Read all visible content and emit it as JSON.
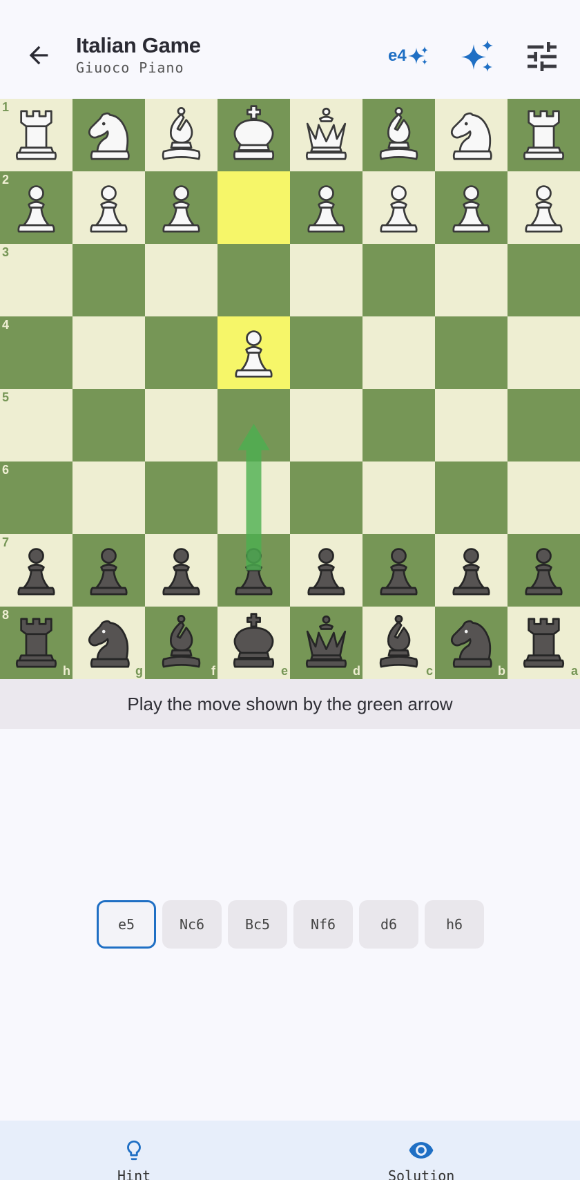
{
  "header": {
    "title": "Italian Game",
    "subtitle": "Giuoco Piano",
    "current_move": "e4",
    "back_icon": "arrow-back-icon",
    "sparkle_icon": "ai-sparkle-icon",
    "settings_icon": "tune-icon",
    "accent": "#1f6fc4"
  },
  "board": {
    "orientation": "black-bottom",
    "light_color": "#eeeed2",
    "dark_color": "#769656",
    "highlight_color": "#f6f669",
    "ranks": [
      "1",
      "2",
      "3",
      "4",
      "5",
      "6",
      "7",
      "8"
    ],
    "files": [
      "h",
      "g",
      "f",
      "e",
      "d",
      "c",
      "b",
      "a"
    ],
    "highlights": [
      "e2",
      "e4"
    ],
    "arrow": {
      "from": "e7",
      "to": "e5",
      "color": "#4caf50"
    },
    "pieces": [
      {
        "sq": "h1",
        "type": "R",
        "color": "w"
      },
      {
        "sq": "g1",
        "type": "N",
        "color": "w"
      },
      {
        "sq": "f1",
        "type": "B",
        "color": "w"
      },
      {
        "sq": "e1",
        "type": "K",
        "color": "w"
      },
      {
        "sq": "d1",
        "type": "Q",
        "color": "w"
      },
      {
        "sq": "c1",
        "type": "B",
        "color": "w"
      },
      {
        "sq": "b1",
        "type": "N",
        "color": "w"
      },
      {
        "sq": "a1",
        "type": "R",
        "color": "w"
      },
      {
        "sq": "h2",
        "type": "P",
        "color": "w"
      },
      {
        "sq": "g2",
        "type": "P",
        "color": "w"
      },
      {
        "sq": "f2",
        "type": "P",
        "color": "w"
      },
      {
        "sq": "d2",
        "type": "P",
        "color": "w"
      },
      {
        "sq": "c2",
        "type": "P",
        "color": "w"
      },
      {
        "sq": "b2",
        "type": "P",
        "color": "w"
      },
      {
        "sq": "a2",
        "type": "P",
        "color": "w"
      },
      {
        "sq": "e4",
        "type": "P",
        "color": "w"
      },
      {
        "sq": "h7",
        "type": "P",
        "color": "b"
      },
      {
        "sq": "g7",
        "type": "P",
        "color": "b"
      },
      {
        "sq": "f7",
        "type": "P",
        "color": "b"
      },
      {
        "sq": "e7",
        "type": "P",
        "color": "b"
      },
      {
        "sq": "d7",
        "type": "P",
        "color": "b"
      },
      {
        "sq": "c7",
        "type": "P",
        "color": "b"
      },
      {
        "sq": "b7",
        "type": "P",
        "color": "b"
      },
      {
        "sq": "a7",
        "type": "P",
        "color": "b"
      },
      {
        "sq": "h8",
        "type": "R",
        "color": "b"
      },
      {
        "sq": "g8",
        "type": "N",
        "color": "b"
      },
      {
        "sq": "f8",
        "type": "B",
        "color": "b"
      },
      {
        "sq": "e8",
        "type": "K",
        "color": "b"
      },
      {
        "sq": "d8",
        "type": "Q",
        "color": "b"
      },
      {
        "sq": "c8",
        "type": "B",
        "color": "b"
      },
      {
        "sq": "b8",
        "type": "N",
        "color": "b"
      },
      {
        "sq": "a8",
        "type": "R",
        "color": "b"
      }
    ]
  },
  "instruction": "Play the move shown by the green arrow",
  "choices": [
    {
      "label": "e5",
      "selected": true
    },
    {
      "label": "Nc6",
      "selected": false
    },
    {
      "label": "Bc5",
      "selected": false
    },
    {
      "label": "Nf6",
      "selected": false
    },
    {
      "label": "d6",
      "selected": false
    },
    {
      "label": "h6",
      "selected": false
    }
  ],
  "bottom_nav": {
    "hint_label": "Hint",
    "hint_icon": "lightbulb-icon",
    "solution_label": "Solution",
    "solution_icon": "eye-icon"
  }
}
